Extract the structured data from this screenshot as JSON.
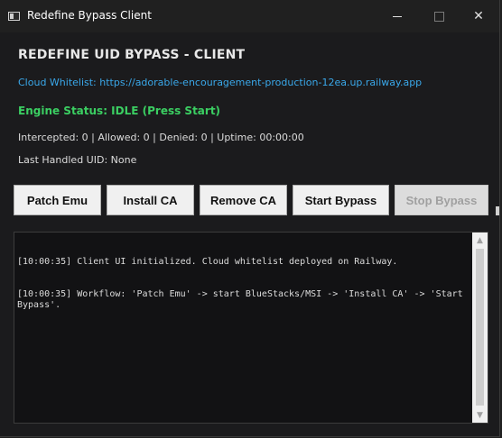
{
  "window": {
    "title": "Redefine Bypass Client",
    "icon": "app-window-icon",
    "controls": {
      "minimize": "minimize-icon",
      "maximize": "maximize-icon",
      "close": "close-icon",
      "close_glyph": "✕"
    }
  },
  "header": {
    "title": "REDEFINE UID BYPASS - CLIENT",
    "whitelist": "Cloud Whitelist: https://adorable-encouragement-production-12ea.up.railway.app",
    "engine_status": "Engine Status: IDLE (Press Start)",
    "stats": "Intercepted: 0  |  Allowed: 0  |  Denied: 0  |  Uptime: 00:00:00",
    "last_uid": "Last Handled UID: None"
  },
  "buttons": {
    "patch_emu": "Patch Emu",
    "install_ca": "Install CA",
    "remove_ca": "Remove CA",
    "start_bypass": "Start Bypass",
    "stop_bypass": "Stop Bypass"
  },
  "log": {
    "lines": [
      "[10:00:35] Client UI initialized. Cloud whitelist deployed on Railway.",
      "[10:00:35] Workflow: 'Patch Emu' -> start BlueStacks/MSI -> 'Install CA' -> 'Start Bypass'."
    ],
    "scroll_up": "▲",
    "scroll_down": "▼"
  },
  "colors": {
    "background": "#1b1b1d",
    "link": "#3aa8ea",
    "status_idle": "#3bcf62",
    "button": "#f0f0f0"
  }
}
